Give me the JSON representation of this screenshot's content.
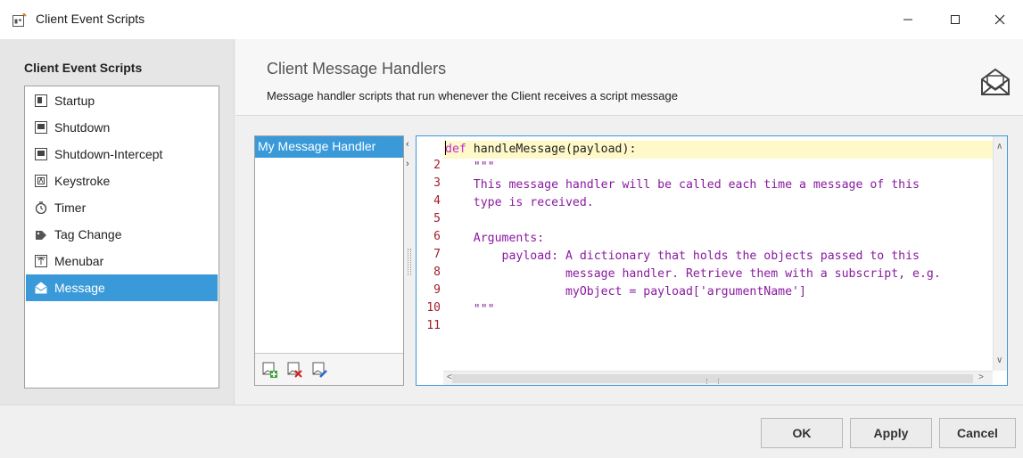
{
  "window": {
    "title": "Client Event Scripts",
    "controls": {
      "minimize": "—",
      "maximize": "☐",
      "close": "✕"
    }
  },
  "sidebar": {
    "heading": "Client Event Scripts",
    "items": [
      {
        "label": "Startup",
        "icon": "startup-icon"
      },
      {
        "label": "Shutdown",
        "icon": "shutdown-icon"
      },
      {
        "label": "Shutdown-Intercept",
        "icon": "shutdown-intercept-icon"
      },
      {
        "label": "Keystroke",
        "icon": "keystroke-icon"
      },
      {
        "label": "Timer",
        "icon": "timer-icon"
      },
      {
        "label": "Tag Change",
        "icon": "tag-change-icon"
      },
      {
        "label": "Menubar",
        "icon": "menubar-icon"
      },
      {
        "label": "Message",
        "icon": "message-icon",
        "selected": true
      }
    ]
  },
  "header": {
    "title": "Client Message Handlers",
    "subtitle": "Message handler scripts that run whenever the Client receives a script message"
  },
  "handlers": {
    "items": [
      {
        "label": "My Message Handler",
        "selected": true
      }
    ],
    "toolbar": [
      "add-handler-icon",
      "delete-handler-icon",
      "edit-handler-icon"
    ]
  },
  "editor": {
    "line_numbers": [
      "",
      "2",
      "3",
      "4",
      "5",
      "6",
      "7",
      "8",
      "9",
      "10",
      "11"
    ],
    "lines": [
      "def handleMessage(payload):",
      "    \"\"\"",
      "    This message handler will be called each time a message of this",
      "    type is received.",
      "",
      "    Arguments:",
      "        payload: A dictionary that holds the objects passed to this",
      "                 message handler. Retrieve them with a subscript, e.g.",
      "                 myObject = payload['argumentName']",
      "    \"\"\"",
      ""
    ],
    "first_line": {
      "keyword": "def",
      "rest": " handleMessage(payload):"
    }
  },
  "splitter": {
    "left_arrow": "‹",
    "right_arrow": "›"
  },
  "footer": {
    "ok_label": "OK",
    "apply_label": "Apply",
    "cancel_label": "Cancel"
  },
  "colors": {
    "selection": "#3a9ad9",
    "line_numbers": "#a0202a",
    "code_text": "#8a1aa0",
    "current_line": "#fff8c8"
  }
}
